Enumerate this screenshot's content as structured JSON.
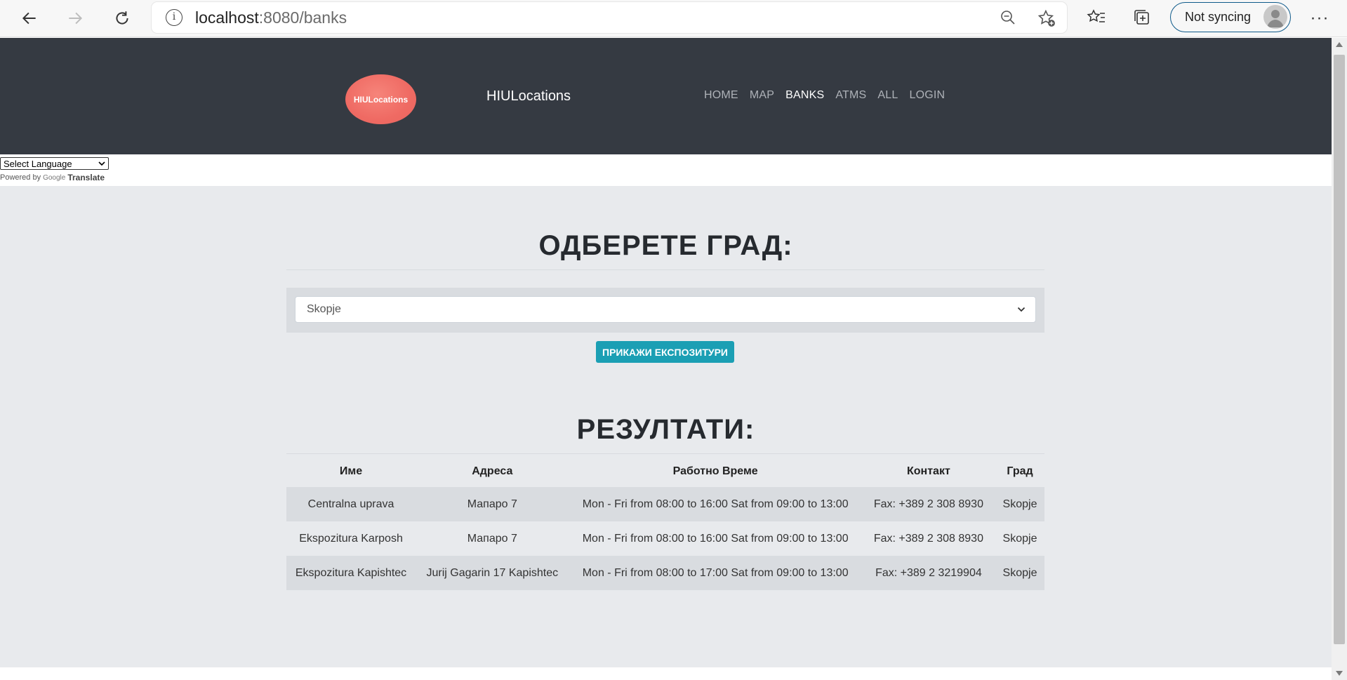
{
  "browser": {
    "url_host": "localhost",
    "url_path": ":8080/banks",
    "sync_label": "Not syncing"
  },
  "site": {
    "logo_text": "HIULocations",
    "brand": "HIULocations",
    "nav": [
      "HOME",
      "MAP",
      "BANKS",
      "ATMS",
      "ALL",
      "LOGIN"
    ],
    "active_nav": "BANKS"
  },
  "translate": {
    "select_label": "Select Language",
    "powered_by": "Powered by",
    "google": "Google",
    "translate": "Translate"
  },
  "main": {
    "select_heading": "ОДБЕРЕТЕ ГРАД:",
    "selected_city": "Skopje",
    "show_button": "ПРИКАЖИ ЕКСПОЗИТУРИ",
    "results_heading": "РЕЗУЛТАТИ:",
    "table": {
      "headers": [
        "Име",
        "Адреса",
        "Работно Време",
        "Контакт",
        "Град"
      ],
      "rows": [
        [
          "Centralna uprava",
          "Мапаро 7",
          "Mon - Fri from 08:00 to 16:00 Sat from 09:00 to 13:00",
          "Fax: +389 2 308 8930",
          "Skopje"
        ],
        [
          "Ekspozitura Karposh",
          "Мапаро 7",
          "Mon - Fri from 08:00 to 16:00 Sat from 09:00 to 13:00",
          "Fax: +389 2 308 8930",
          "Skopje"
        ],
        [
          "Ekspozitura Kapishtec",
          "Jurij Gagarin 17 Kapishtec",
          "Mon - Fri from 08:00 to 17:00 Sat from 09:00 to 13:00",
          "Fax: +389 2 3219904",
          "Skopje"
        ]
      ]
    }
  },
  "colors": {
    "header_bg": "#353a42",
    "content_bg": "#e8eaed",
    "button_bg": "#1b9fb4",
    "logo": "#ef6a63"
  }
}
